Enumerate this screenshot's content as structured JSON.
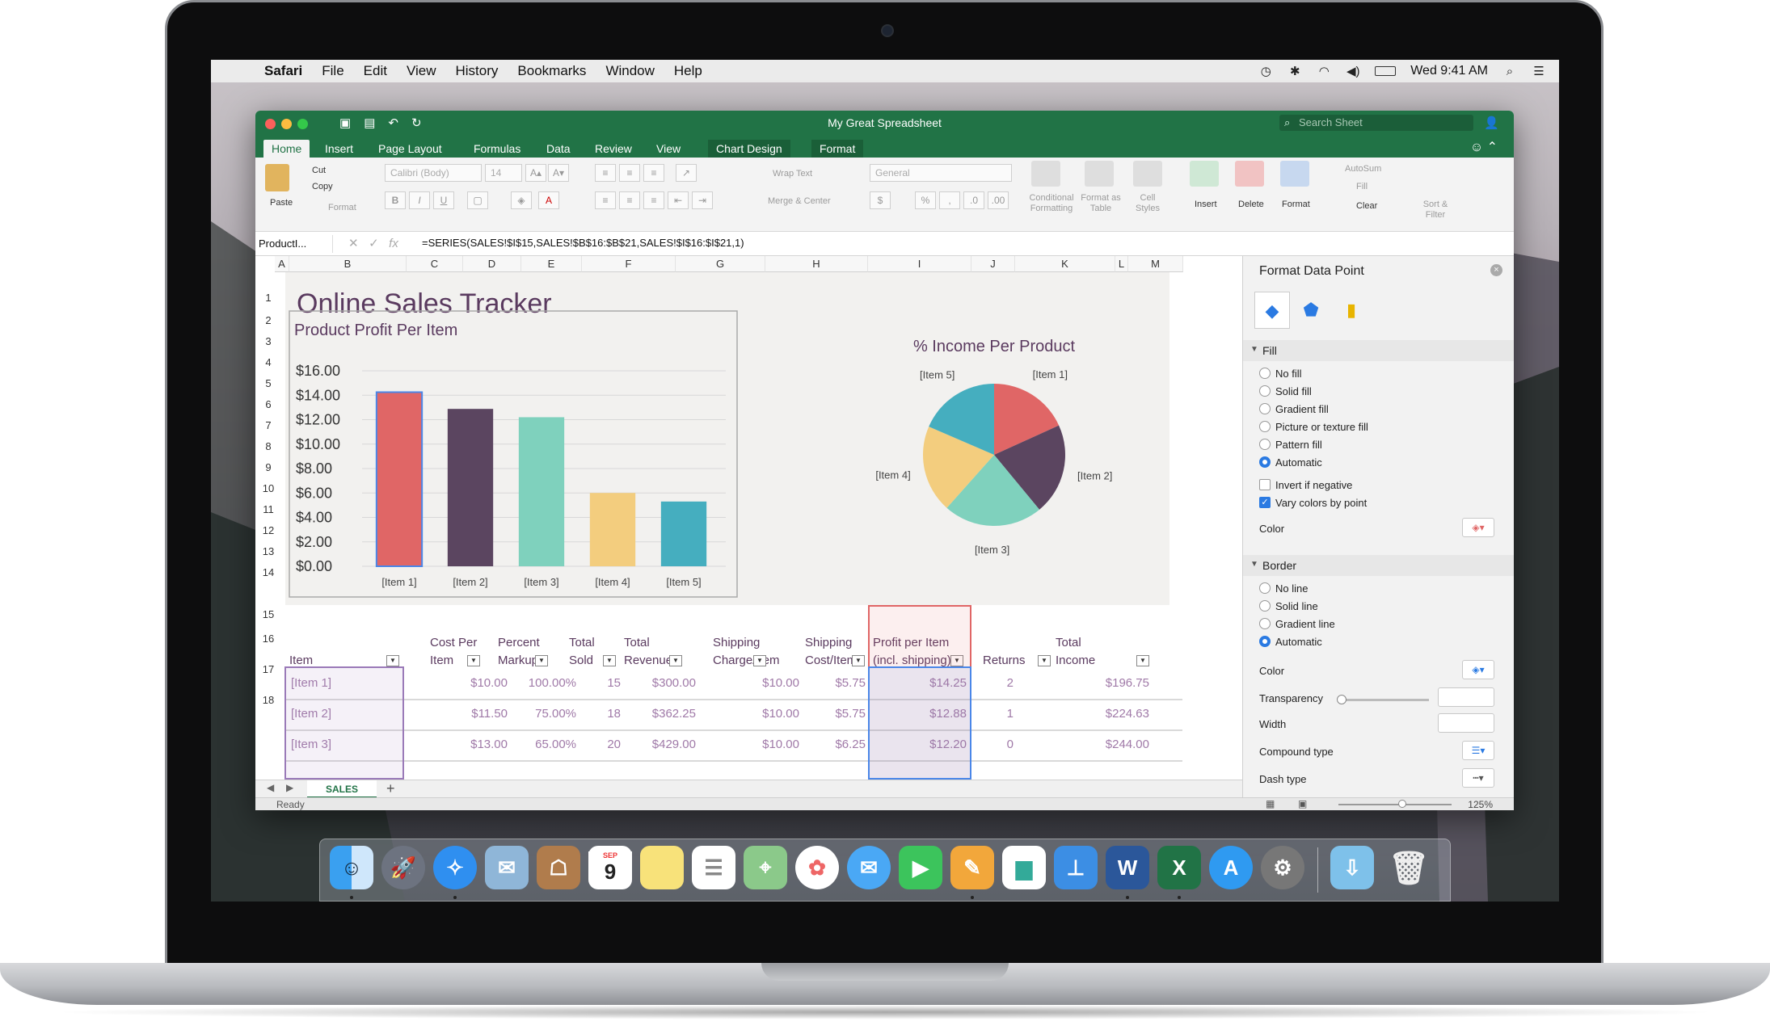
{
  "menubar": {
    "app": "Safari",
    "items": [
      "File",
      "Edit",
      "View",
      "History",
      "Bookmarks",
      "Window",
      "Help"
    ],
    "clock": "Wed 9:41 AM"
  },
  "window": {
    "title": "My Great Spreadsheet",
    "search_placeholder": "Search Sheet"
  },
  "ribbon_tabs": [
    "Home",
    "Insert",
    "Page Layout",
    "Formulas",
    "Data",
    "Review",
    "View",
    "Chart Design",
    "Format"
  ],
  "ribbon": {
    "paste": "Paste",
    "cut": "Cut",
    "copy": "Copy",
    "format_painter": "Format",
    "font": "Calibri (Body)",
    "font_size": "14",
    "wrap_text": "Wrap Text",
    "merge_center": "Merge & Center",
    "number_format": "General",
    "conditional_formatting": "Conditional Formatting",
    "format_as_table": "Format as Table",
    "cell_styles": "Cell Styles",
    "insert": "Insert",
    "delete": "Delete",
    "format": "Format",
    "autosum": "AutoSum",
    "fill": "Fill",
    "clear": "Clear",
    "sort_filter": "Sort & Filter"
  },
  "formula_bar": {
    "name_box": "ProductI...",
    "formula": "=SERIES(SALES!$I$15,SALES!$B$16:$B$21,SALES!$I$16:$I$21,1)"
  },
  "columns": [
    "A",
    "B",
    "C",
    "D",
    "E",
    "F",
    "G",
    "H",
    "I",
    "J",
    "K",
    "L",
    "M"
  ],
  "rows": [
    "1",
    "2",
    "3",
    "4",
    "5",
    "6",
    "7",
    "8",
    "9",
    "10",
    "11",
    "12",
    "13",
    "14",
    "15",
    "16",
    "17",
    "18"
  ],
  "sheet_title": "Online Sales Tracker",
  "chart_data": [
    {
      "type": "bar",
      "title": "Product Profit Per Item",
      "categories": [
        "[Item 1]",
        "[Item 2]",
        "[Item 3]",
        "[Item 4]",
        "[Item 5]"
      ],
      "values": [
        14.25,
        12.88,
        12.2,
        6.0,
        5.3
      ],
      "colors": [
        "#e06666",
        "#5b4560",
        "#7fd1bd",
        "#f3cd7e",
        "#45aebf"
      ],
      "yticks": [
        "$16.00",
        "$14.00",
        "$12.00",
        "$10.00",
        "$8.00",
        "$6.00",
        "$4.00",
        "$2.00",
        "$0.00"
      ],
      "ylim": [
        0,
        16
      ]
    },
    {
      "type": "pie",
      "title": "% Income Per Product",
      "labels": [
        "[Item 1]",
        "[Item 2]",
        "[Item 3]",
        "[Item 4]",
        "[Item 5]"
      ],
      "values": [
        196.75,
        224.63,
        244.0,
        215.0,
        200.0
      ],
      "colors": [
        "#e06666",
        "#5b4560",
        "#7fd1bd",
        "#f3cd7e",
        "#45aebf"
      ]
    }
  ],
  "table": {
    "headers": [
      {
        "line1": "",
        "line2": "Item"
      },
      {
        "line1": "Cost Per",
        "line2": "Item"
      },
      {
        "line1": "Percent",
        "line2": "Markup"
      },
      {
        "line1": "Total",
        "line2": "Sold"
      },
      {
        "line1": "Total",
        "line2": "Revenue"
      },
      {
        "line1": "Shipping",
        "line2": "Charge/Item"
      },
      {
        "line1": "Shipping",
        "line2": "Cost/Item"
      },
      {
        "line1": "Profit per Item",
        "line2": "(incl. shipping)"
      },
      {
        "line1": "",
        "line2": "Returns"
      },
      {
        "line1": "Total",
        "line2": "Income"
      }
    ],
    "rows": [
      [
        "[Item 1]",
        "$10.00",
        "100.00%",
        "15",
        "$300.00",
        "$10.00",
        "$5.75",
        "$14.25",
        "2",
        "$196.75"
      ],
      [
        "[Item 2]",
        "$11.50",
        "75.00%",
        "18",
        "$362.25",
        "$10.00",
        "$5.75",
        "$12.88",
        "1",
        "$224.63"
      ],
      [
        "[Item 3]",
        "$13.00",
        "65.00%",
        "20",
        "$429.00",
        "$10.00",
        "$6.25",
        "$12.20",
        "0",
        "$244.00"
      ]
    ]
  },
  "sheet_tab": "SALES",
  "status": {
    "ready": "Ready",
    "zoom": "125%"
  },
  "pane": {
    "title": "Format Data Point",
    "fill_section": "Fill",
    "fill_options": [
      "No fill",
      "Solid fill",
      "Gradient fill",
      "Picture or texture fill",
      "Pattern fill",
      "Automatic"
    ],
    "invert_if_negative": "Invert if negative",
    "vary_colors": "Vary colors by point",
    "color_label": "Color",
    "border_section": "Border",
    "border_options": [
      "No line",
      "Solid line",
      "Gradient line",
      "Automatic"
    ],
    "border_color": "Color",
    "transparency": "Transparency",
    "width": "Width",
    "compound_type": "Compound type",
    "dash_type": "Dash type"
  },
  "dock": {
    "calendar_month": "SEP",
    "calendar_day": "9"
  }
}
